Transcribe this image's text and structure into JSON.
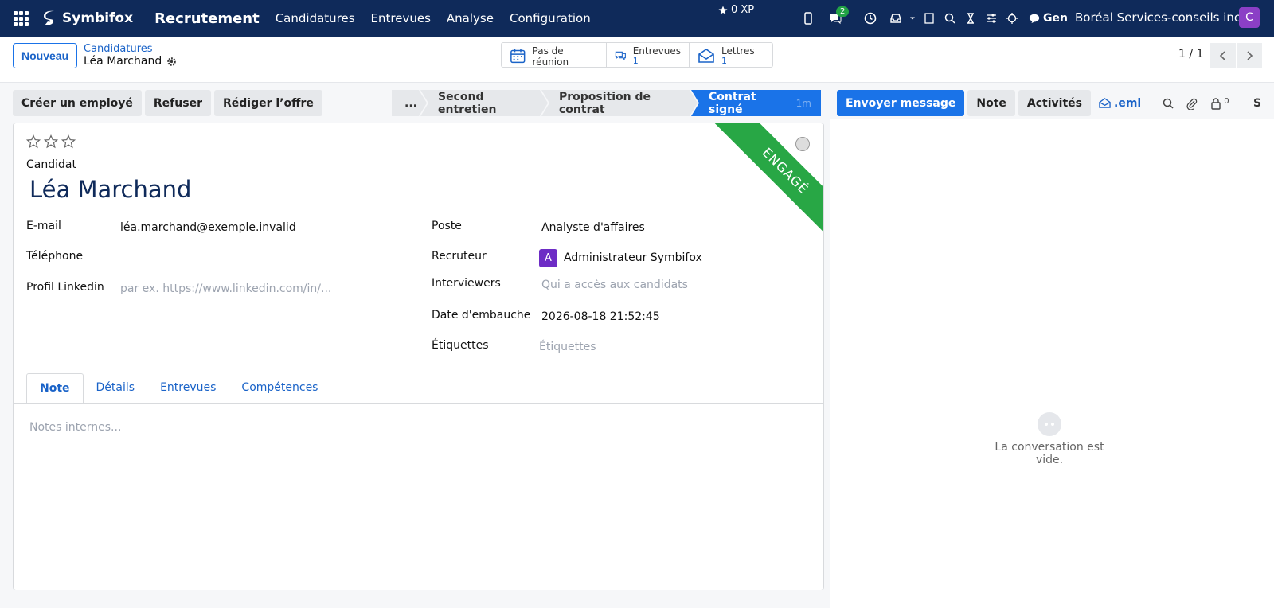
{
  "nav": {
    "brand": "Symbifox",
    "module": "Recrutement",
    "menu": [
      "Candidatures",
      "Entrevues",
      "Analyse",
      "Configuration"
    ],
    "xp": "0 XP",
    "messages_count": "2",
    "user_short": "Gen",
    "company": "Boréal Services-conseils inc.",
    "avatar_letter": "C"
  },
  "control": {
    "new_button": "Nouveau",
    "breadcrumb_parent": "Candidatures",
    "breadcrumb_current": "Léa Marchand",
    "smart_buttons": [
      {
        "label": "Pas de réunion",
        "value": "",
        "icon": "calendar-icon"
      },
      {
        "label": "Entrevues",
        "value": "1",
        "icon": "chat-bubbles-icon"
      },
      {
        "label": "Lettres",
        "value": "1",
        "icon": "envelope-icon"
      }
    ],
    "pager": "1 / 1"
  },
  "statusbar": {
    "actions": [
      "Créer un employé",
      "Refuser",
      "Rédiger l’offre"
    ],
    "stages": [
      "...",
      "Second entretien",
      "Proposition de contrat",
      "Contrat signé"
    ],
    "active_duration": "1m"
  },
  "chatter": {
    "send_message": "Envoyer message",
    "note": "Note",
    "activities": "Activités",
    "eml": ".eml",
    "followers_count": "0",
    "s_letter": "S",
    "empty_text": "La conversation est vide."
  },
  "form": {
    "ribbon": "ENGAGÉ",
    "candidate_label": "Candidat",
    "candidate_name": "Léa Marchand",
    "fields_left": {
      "email_label": "E-mail",
      "email_value": "léa.marchand@exemple.invalid",
      "phone_label": "Téléphone",
      "linkedin_label": "Profil Linkedin",
      "linkedin_placeholder": "par ex. https://www.linkedin.com/in/..."
    },
    "fields_right": {
      "job_label": "Poste",
      "job_value": "Analyste d'affaires",
      "recruiter_label": "Recruteur",
      "recruiter_avatar": "A",
      "recruiter_value": "Administrateur Symbifox",
      "interviewers_label": "Interviewers",
      "interviewers_placeholder": "Qui a accès aux candidats",
      "hire_date_label": "Date d'embauche",
      "hire_date_value": "2026-08-18 21:52:45",
      "tags_label": "Étiquettes",
      "tags_placeholder": "Étiquettes"
    },
    "tabs": [
      "Note",
      "Détails",
      "Entrevues",
      "Compétences"
    ],
    "notes_placeholder": "Notes internes..."
  },
  "colors": {
    "nav_bg": "#0f2a5a",
    "primary": "#1a73e8",
    "ribbon": "#28a745"
  }
}
